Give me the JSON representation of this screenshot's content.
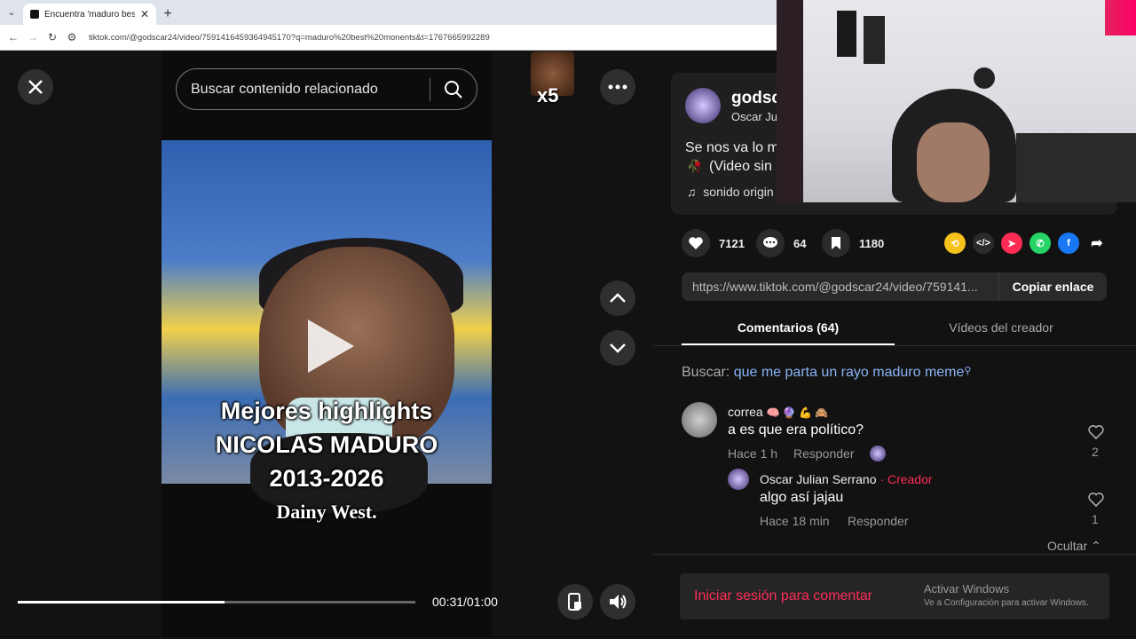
{
  "browser": {
    "tab_title": "Encuentra 'maduro best monen'",
    "url": "tiktok.com/@godscar24/video/7591416459364945170?q=maduro%20best%20monents&t=1767665992289"
  },
  "player": {
    "search_placeholder": "Buscar contenido relacionado",
    "overlay_line1": "Mejores highlights",
    "overlay_line2": "NICOLAS MADURO",
    "overlay_line3": "2013-2026",
    "overlay_line4": "Dainy West.",
    "sticker_text": "x5",
    "time": "00:31/01:00",
    "progress": 0.52
  },
  "author": {
    "username": "godsc",
    "nickname": "Oscar Ju",
    "desc_line1": "Se nos va lo m",
    "desc_line2": "(Video sin",
    "sound": "sonido origin"
  },
  "stats": {
    "likes": "7121",
    "comments": "64",
    "saves": "1180"
  },
  "share_link": {
    "url": "https://www.tiktok.com/@godscar24/video/759141...",
    "copy_label": "Copiar enlace"
  },
  "tabs": {
    "comments": "Comentarios (64)",
    "creator_videos": "Vídeos del creador"
  },
  "search_hint": {
    "label": "Buscar:",
    "query": "que me parta un rayo maduro meme"
  },
  "comments": [
    {
      "name": "correa",
      "text": "a es que era político?",
      "time": "Hace 1 h",
      "reply": "Responder",
      "likes": "2"
    },
    {
      "name": "Oscar Julian Serrano",
      "creator_tag": "· Creador",
      "text": "algo así jajau",
      "time": "Hace 18 min",
      "reply": "Responder",
      "likes": "1"
    }
  ],
  "hide_label": "Ocultar",
  "login_prompt": "Iniciar sesión para comentar",
  "windows_watermark": {
    "line1": "Activar Windows",
    "line2": "Ve a Configuración para activar Windows."
  },
  "colors": {
    "accent_red": "#fe2c55",
    "link_blue": "#8ab4f8"
  }
}
